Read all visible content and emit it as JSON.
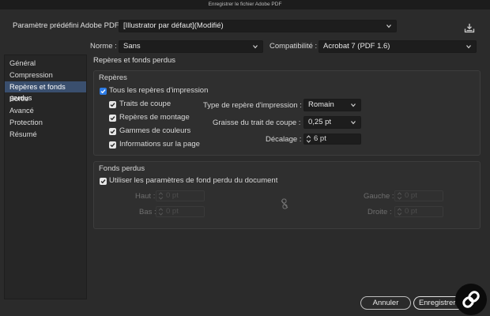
{
  "window": {
    "title": "Enregistrer le fichier Adobe PDF"
  },
  "preset": {
    "label": "Paramètre prédéfini Adobe PDF :",
    "value": "[Illustrator par défaut](Modifié)"
  },
  "norme": {
    "label": "Norme :",
    "value": "Sans"
  },
  "compat": {
    "label": "Compatibilité :",
    "value": "Acrobat 7 (PDF 1.6)"
  },
  "sidebar": {
    "items": [
      {
        "label": "Général",
        "active": false
      },
      {
        "label": "Compression",
        "active": false
      },
      {
        "label": "Repères et fonds perdus",
        "active": true
      },
      {
        "label": "Sortie",
        "active": false
      },
      {
        "label": "Avancé",
        "active": false
      },
      {
        "label": "Protection",
        "active": false
      },
      {
        "label": "Résumé",
        "active": false
      }
    ]
  },
  "panel": {
    "title": "Repères et fonds perdus"
  },
  "marks": {
    "section_title": "Repères",
    "all_marks": {
      "label": "Tous les repères d'impression",
      "checked": true
    },
    "crop": {
      "label": "Traits de coupe",
      "checked": true
    },
    "registration": {
      "label": "Repères de montage",
      "checked": true
    },
    "color_bars": {
      "label": "Gammes de couleurs",
      "checked": true
    },
    "page_info": {
      "label": "Informations sur la page",
      "checked": true
    },
    "type": {
      "label": "Type de repère d'impression :",
      "value": "Romain"
    },
    "weight": {
      "label": "Graisse du trait de coupe :",
      "value": "0,25 pt"
    },
    "offset": {
      "label": "Décalage :",
      "value": "6 pt"
    }
  },
  "bleed": {
    "section_title": "Fonds perdus",
    "use_doc": {
      "label": "Utiliser les paramètres de fond perdu du document",
      "checked": true
    },
    "top": {
      "label": "Haut :",
      "value": "0 pt"
    },
    "bottom": {
      "label": "Bas :",
      "value": "0 pt"
    },
    "left": {
      "label": "Gauche :",
      "value": "0 pt"
    },
    "right": {
      "label": "Droite :",
      "value": "0 pt"
    }
  },
  "buttons": {
    "cancel": "Annuler",
    "save": "Enregistrer PDF"
  },
  "colors": {
    "accent": "#2c7be5",
    "selected_row": "#3a4f6e",
    "background": "#2b2b2b"
  },
  "icons": {
    "save_preset": "save-preset-icon",
    "link": "link-chain-icon",
    "logo": "chain-logo-icon"
  }
}
